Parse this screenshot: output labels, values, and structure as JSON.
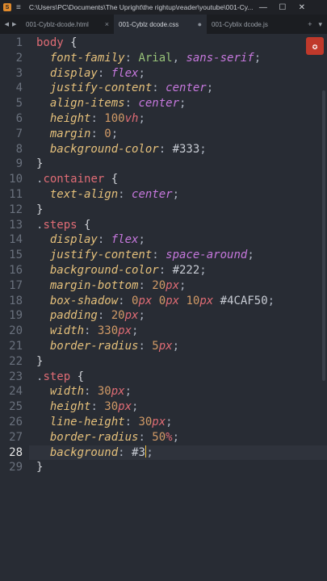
{
  "window": {
    "title": "C:\\Users\\PC\\Documents\\The Upright\\the rightup\\reader\\youtube\\001-Cy...",
    "minimize": "—",
    "maximize": "☐",
    "close": "✕"
  },
  "tabs": [
    {
      "label": "001-Cyblz-dcode.html",
      "close": "×",
      "active": false
    },
    {
      "label": "001-Cyblz dcode.css",
      "close": "●",
      "active": true
    },
    {
      "label": "001-Cyblix dcode.js",
      "close": "×",
      "active": false
    }
  ],
  "tab_tools": {
    "add": "+",
    "menu": "▾"
  },
  "editor": {
    "current_line": 28,
    "line_numbers": [
      "1",
      "2",
      "3",
      "4",
      "5",
      "6",
      "7",
      "8",
      "9",
      "10",
      "11",
      "12",
      "13",
      "14",
      "15",
      "16",
      "17",
      "18",
      "19",
      "20",
      "21",
      "22",
      "23",
      "24",
      "25",
      "26",
      "27",
      "28",
      "29"
    ],
    "lines": [
      [
        [
          "sel",
          "body"
        ],
        [
          "brace",
          " {"
        ]
      ],
      [
        [
          "prop",
          "  font-family"
        ],
        [
          "punct",
          ": "
        ],
        [
          "val",
          "Arial"
        ],
        [
          "punct",
          ", "
        ],
        [
          "kw",
          "sans-serif"
        ],
        [
          "punct",
          ";"
        ]
      ],
      [
        [
          "prop",
          "  display"
        ],
        [
          "punct",
          ": "
        ],
        [
          "kw",
          "flex"
        ],
        [
          "punct",
          ";"
        ]
      ],
      [
        [
          "prop",
          "  justify-content"
        ],
        [
          "punct",
          ": "
        ],
        [
          "kw",
          "center"
        ],
        [
          "punct",
          ";"
        ]
      ],
      [
        [
          "prop",
          "  align-items"
        ],
        [
          "punct",
          ": "
        ],
        [
          "kw",
          "center"
        ],
        [
          "punct",
          ";"
        ]
      ],
      [
        [
          "prop",
          "  height"
        ],
        [
          "punct",
          ": "
        ],
        [
          "num",
          "100"
        ],
        [
          "unit",
          "vh"
        ],
        [
          "punct",
          ";"
        ]
      ],
      [
        [
          "prop",
          "  margin"
        ],
        [
          "punct",
          ": "
        ],
        [
          "num",
          "0"
        ],
        [
          "punct",
          ";"
        ]
      ],
      [
        [
          "prop",
          "  background-color"
        ],
        [
          "punct",
          ": "
        ],
        [
          "hex",
          "#333"
        ],
        [
          "punct",
          ";"
        ]
      ],
      [
        [
          "brace",
          "}"
        ]
      ],
      [
        [
          "punct",
          "."
        ],
        [
          "sel",
          "container"
        ],
        [
          "brace",
          " {"
        ]
      ],
      [
        [
          "prop",
          "  text-align"
        ],
        [
          "punct",
          ": "
        ],
        [
          "kw",
          "center"
        ],
        [
          "punct",
          ";"
        ]
      ],
      [
        [
          "brace",
          "}"
        ]
      ],
      [
        [
          "punct",
          "."
        ],
        [
          "sel",
          "steps"
        ],
        [
          "brace",
          " {"
        ]
      ],
      [
        [
          "prop",
          "  display"
        ],
        [
          "punct",
          ": "
        ],
        [
          "kw",
          "flex"
        ],
        [
          "punct",
          ";"
        ]
      ],
      [
        [
          "prop",
          "  justify-content"
        ],
        [
          "punct",
          ": "
        ],
        [
          "kw",
          "space-around"
        ],
        [
          "punct",
          ";"
        ]
      ],
      [
        [
          "prop",
          "  background-color"
        ],
        [
          "punct",
          ": "
        ],
        [
          "hex",
          "#222"
        ],
        [
          "punct",
          ";"
        ]
      ],
      [
        [
          "prop",
          "  margin-bottom"
        ],
        [
          "punct",
          ": "
        ],
        [
          "num",
          "20"
        ],
        [
          "unit",
          "px"
        ],
        [
          "punct",
          ";"
        ]
      ],
      [
        [
          "prop",
          "  box-shadow"
        ],
        [
          "punct",
          ": "
        ],
        [
          "num",
          "0"
        ],
        [
          "unit",
          "px "
        ],
        [
          "num",
          "0"
        ],
        [
          "unit",
          "px "
        ],
        [
          "num",
          "10"
        ],
        [
          "unit",
          "px "
        ],
        [
          "hex",
          "#4CAF50"
        ],
        [
          "punct",
          ";"
        ]
      ],
      [
        [
          "prop",
          "  padding"
        ],
        [
          "punct",
          ": "
        ],
        [
          "num",
          "20"
        ],
        [
          "unit",
          "px"
        ],
        [
          "punct",
          ";"
        ]
      ],
      [
        [
          "prop",
          "  width"
        ],
        [
          "punct",
          ": "
        ],
        [
          "num",
          "330"
        ],
        [
          "unit",
          "px"
        ],
        [
          "punct",
          ";"
        ]
      ],
      [
        [
          "prop",
          "  border-radius"
        ],
        [
          "punct",
          ": "
        ],
        [
          "num",
          "5"
        ],
        [
          "unit",
          "px"
        ],
        [
          "punct",
          ";"
        ]
      ],
      [
        [
          "brace",
          "}"
        ]
      ],
      [
        [
          "punct",
          "."
        ],
        [
          "sel",
          "step"
        ],
        [
          "brace",
          " {"
        ]
      ],
      [
        [
          "prop",
          "  width"
        ],
        [
          "punct",
          ": "
        ],
        [
          "num",
          "30"
        ],
        [
          "unit",
          "px"
        ],
        [
          "punct",
          ";"
        ]
      ],
      [
        [
          "prop",
          "  height"
        ],
        [
          "punct",
          ": "
        ],
        [
          "num",
          "30"
        ],
        [
          "unit",
          "px"
        ],
        [
          "punct",
          ";"
        ]
      ],
      [
        [
          "prop",
          "  line-height"
        ],
        [
          "punct",
          ": "
        ],
        [
          "num",
          "30"
        ],
        [
          "unit",
          "px"
        ],
        [
          "punct",
          ";"
        ]
      ],
      [
        [
          "prop",
          "  border-radius"
        ],
        [
          "punct",
          ": "
        ],
        [
          "num",
          "50"
        ],
        [
          "unit",
          "%"
        ],
        [
          "punct",
          ";"
        ]
      ],
      [
        [
          "prop",
          "  background"
        ],
        [
          "punct",
          ": "
        ],
        [
          "hex",
          "#3"
        ],
        [
          "cursor",
          ""
        ],
        [
          "punct",
          ";"
        ]
      ],
      [
        [
          "brace",
          "}"
        ]
      ]
    ]
  },
  "side_button_icon": "stamp-icon",
  "colors": {
    "accent": "#c0392b",
    "cursor": "#f0c040"
  }
}
